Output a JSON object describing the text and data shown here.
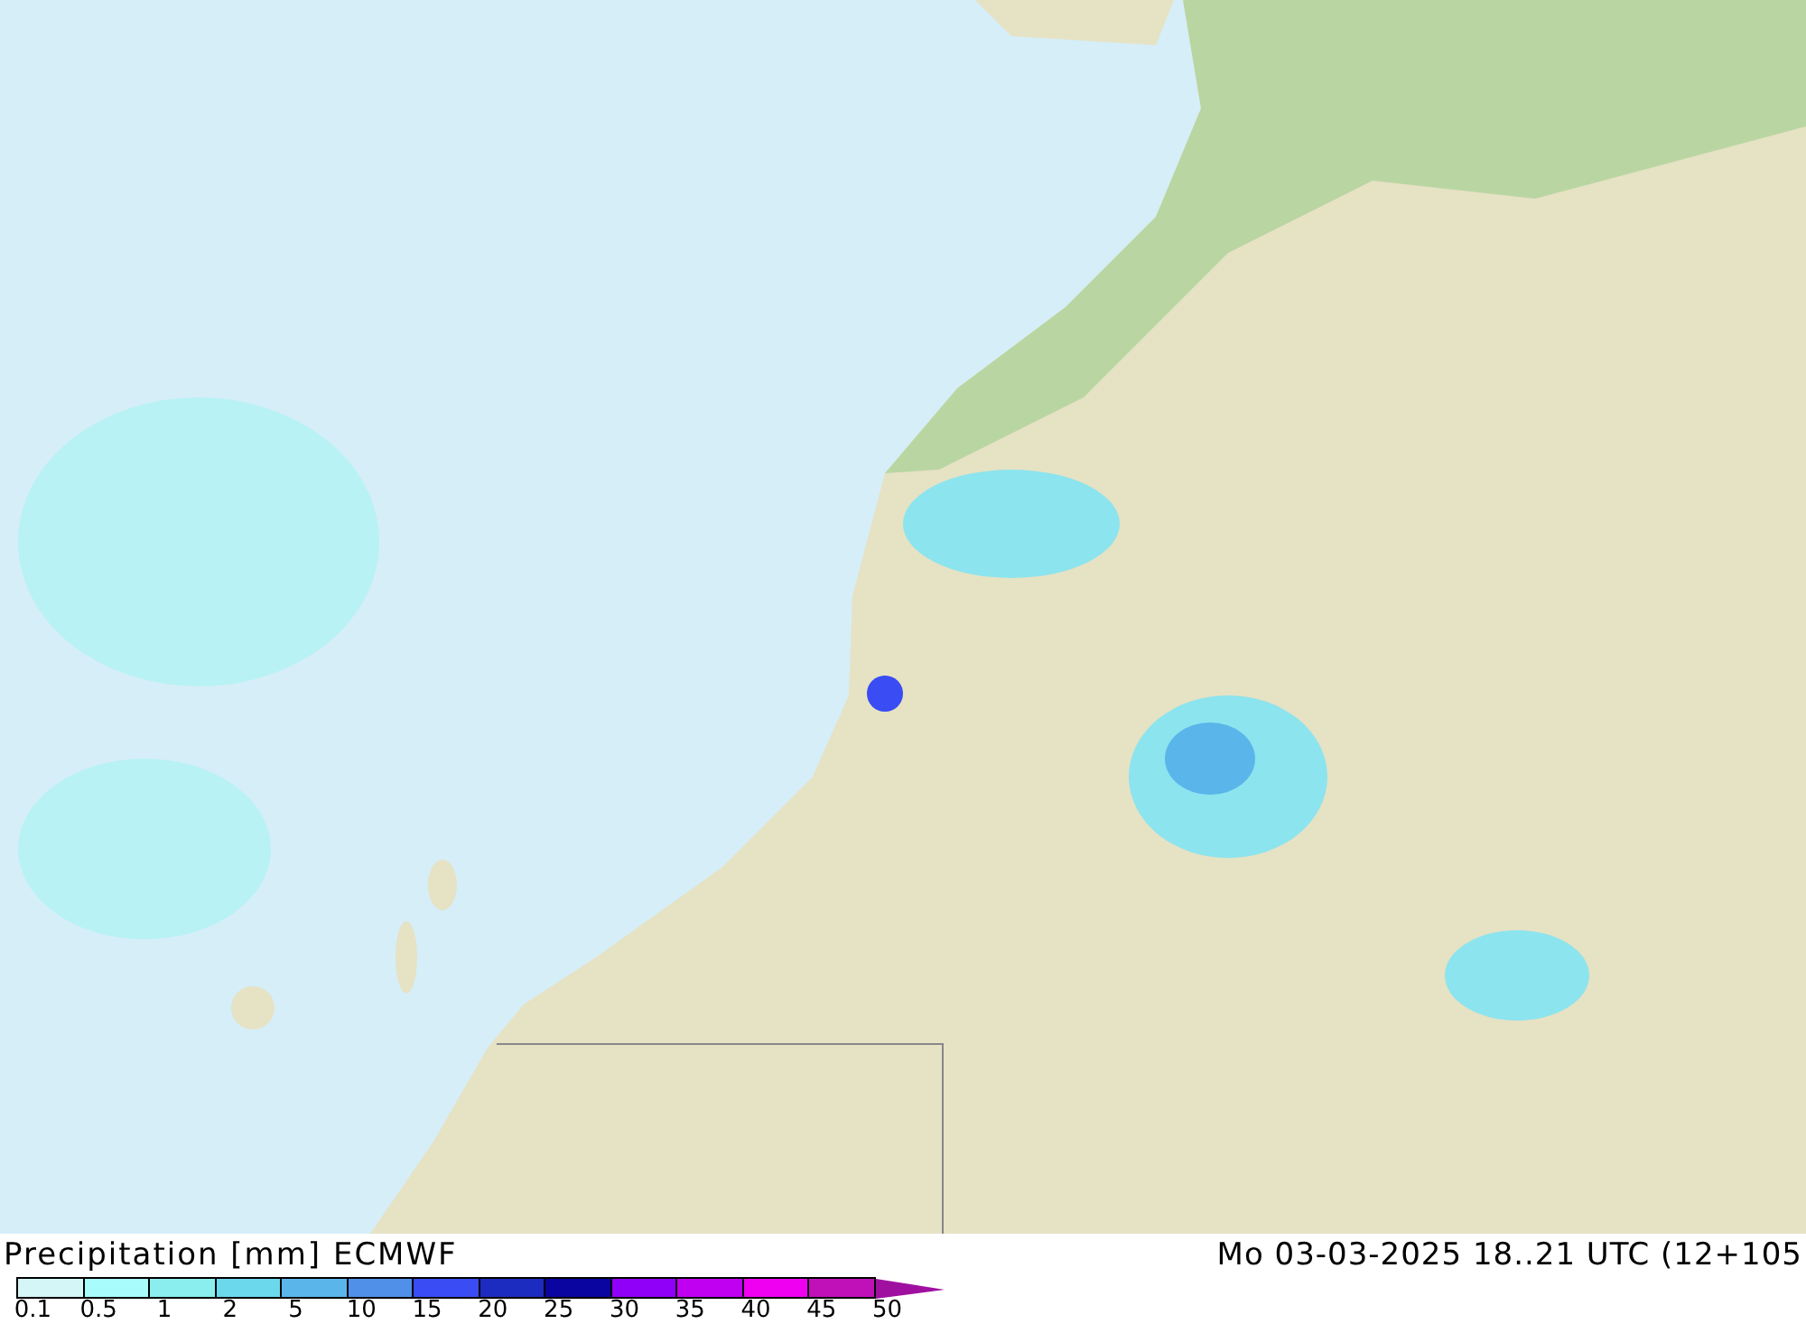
{
  "title": "Precipitation [mm] ECMWF",
  "valid_time": "Mo 03-03-2025 18..21 UTC (12+105",
  "legend": {
    "bins": [
      {
        "color": "#d4f6f6"
      },
      {
        "color": "#a8fcfc"
      },
      {
        "color": "#8aeeee"
      },
      {
        "color": "#6cd8ec"
      },
      {
        "color": "#5ab6ea"
      },
      {
        "color": "#5090e8"
      },
      {
        "color": "#3a4cf4"
      },
      {
        "color": "#1c2cc0"
      },
      {
        "color": "#0a04a0"
      },
      {
        "color": "#9000f8"
      },
      {
        "color": "#c000f0"
      },
      {
        "color": "#f000f0"
      },
      {
        "color": "#c010b8"
      }
    ],
    "ticks": [
      "0.1",
      "0.5",
      "1",
      "2",
      "5",
      "10",
      "15",
      "20",
      "25",
      "30",
      "35",
      "40",
      "45",
      "50"
    ]
  }
}
